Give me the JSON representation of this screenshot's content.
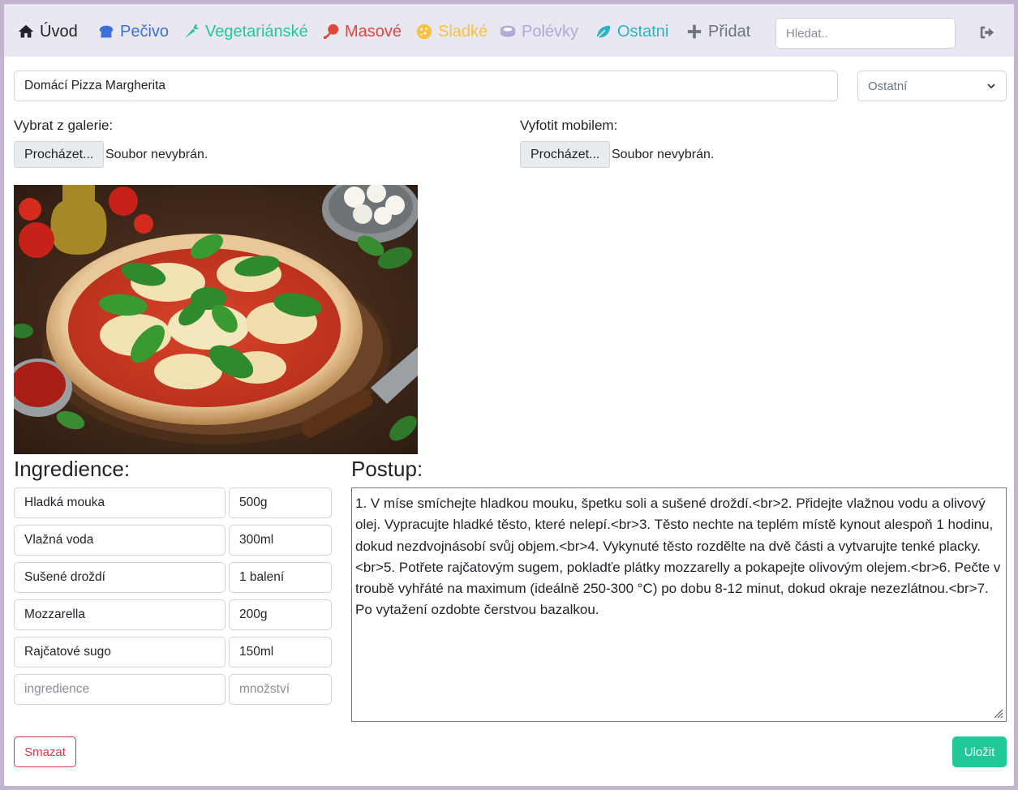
{
  "nav": {
    "items": [
      {
        "label": "Úvod",
        "icon": "home-icon",
        "color": "#212529"
      },
      {
        "label": "Pečivo",
        "icon": "bread-icon",
        "color": "#3d6fd6"
      },
      {
        "label": "Vegetariánské",
        "icon": "carrot-icon",
        "color": "#20c997"
      },
      {
        "label": "Masové",
        "icon": "drumstick-icon",
        "color": "#e0463a"
      },
      {
        "label": "Sladké",
        "icon": "cookie-icon",
        "color": "#f5c242"
      },
      {
        "label": "Polévky",
        "icon": "soup-icon",
        "color": "#b4a7d6"
      },
      {
        "label": "Ostatni",
        "icon": "leaf-icon",
        "color": "#2ab3c4"
      },
      {
        "label": "Přidat",
        "icon": "plus-icon",
        "color": "#6c757d"
      }
    ],
    "search_placeholder": "Hledat..",
    "logout_icon": "sign-out-icon"
  },
  "recipe": {
    "title": "Domácí Pizza Margherita",
    "category": "Ostatní"
  },
  "upload": {
    "gallery_label": "Vybrat z galerie:",
    "camera_label": "Vyfotit mobilem:",
    "browse_label": "Procházet...",
    "no_file": "Soubor nevybrán."
  },
  "ingredients": {
    "heading": "Ingredience:",
    "rows": [
      {
        "name": "Hladká mouka",
        "amount": "500g"
      },
      {
        "name": "Vlažná voda",
        "amount": "300ml"
      },
      {
        "name": "Sušené droždí",
        "amount": "1 balení"
      },
      {
        "name": "Mozzarella",
        "amount": "200g"
      },
      {
        "name": "Rajčatové sugo",
        "amount": "150ml"
      }
    ],
    "name_placeholder": "ingredience",
    "amount_placeholder": "množství"
  },
  "procedure": {
    "heading": "Postup:",
    "text": "1. V míse smíchejte hladkou mouku, špetku soli a sušené droždí.<br>2. Přidejte vlažnou vodu a olivový olej. Vypracujte hladké těsto, které nelepí.<br>3. Těsto nechte na teplém místě kynout alespoň 1 hodinu, dokud nezdvojnásobí svůj objem.<br>4. Vykynuté těsto rozdělte na dvě části a vytvarujte tenké placky.<br>5. Potřete rajčatovým sugem, pokladťe plátky mozzarelly a pokapejte olivovým olejem.<br>6. Pečte v troubě vyhřáté na maximum (ideálně 250-300 °C) po dobu 8-12 minut, dokud okraje nezezlátnou.<br>7. Po vytažení ozdobte čerstvou bazalkou."
  },
  "actions": {
    "delete_label": "Smazat",
    "save_label": "Uložit"
  }
}
